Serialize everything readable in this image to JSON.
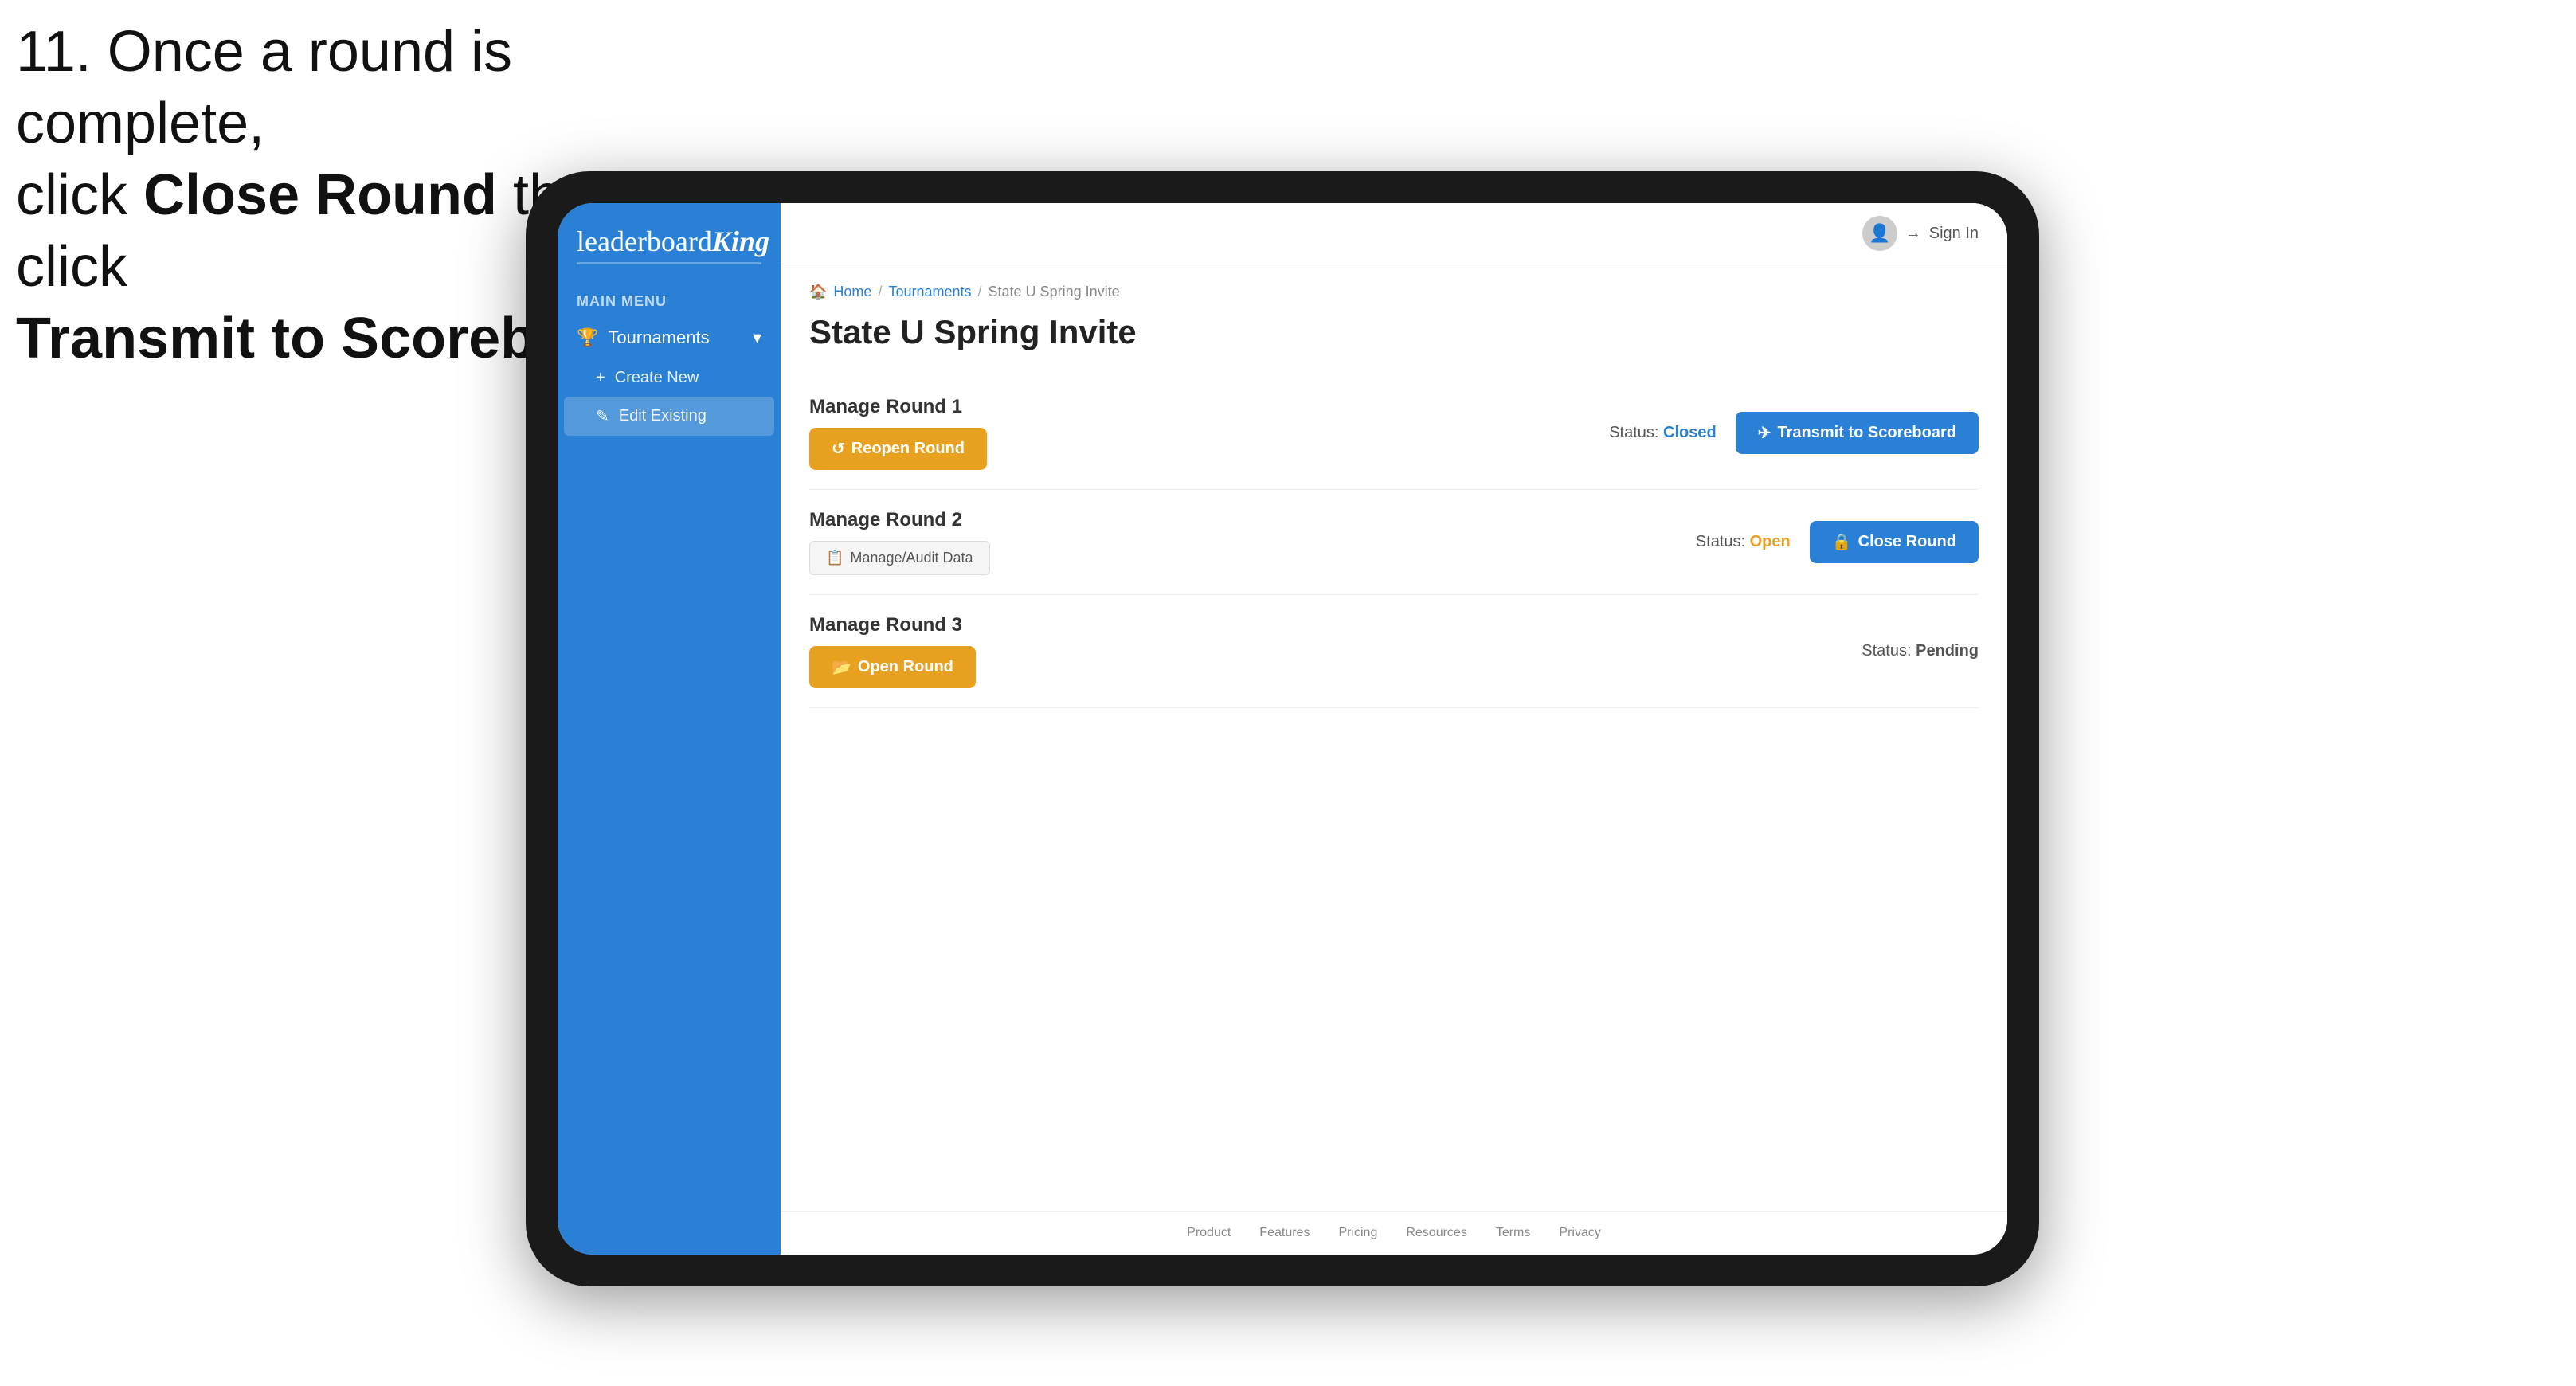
{
  "instruction": {
    "line1": "11. Once a round is complete,",
    "line2_prefix": "click ",
    "line2_bold": "Close Round",
    "line2_suffix": " then click",
    "line3_bold": "Transmit to Scoreboard."
  },
  "app": {
    "logo": {
      "leaderboard": "leaderboard",
      "king": "King"
    },
    "sidebar": {
      "main_menu_label": "MAIN MENU",
      "items": [
        {
          "label": "Tournaments",
          "icon": "trophy-icon",
          "expanded": true
        }
      ],
      "sub_items": [
        {
          "label": "Create New",
          "icon": "plus-icon"
        },
        {
          "label": "Edit Existing",
          "icon": "edit-icon",
          "active": true
        }
      ]
    },
    "header": {
      "sign_in_label": "Sign In"
    },
    "breadcrumb": {
      "home": "Home",
      "tournaments": "Tournaments",
      "current": "State U Spring Invite"
    },
    "page_title": "State U Spring Invite",
    "rounds": [
      {
        "label": "Manage Round 1",
        "status_label": "Status:",
        "status_value": "Closed",
        "status_type": "closed",
        "buttons": [
          {
            "id": "reopen",
            "label": "Reopen Round",
            "icon": "reopen-icon"
          },
          {
            "id": "transmit",
            "label": "Transmit to Scoreboard",
            "icon": "transmit-icon"
          }
        ]
      },
      {
        "label": "Manage Round 2",
        "status_label": "Status:",
        "status_value": "Open",
        "status_type": "open",
        "buttons": [
          {
            "id": "manage-audit",
            "label": "Manage/Audit Data",
            "icon": "manage-icon"
          },
          {
            "id": "close-round",
            "label": "Close Round",
            "icon": "close-icon"
          }
        ]
      },
      {
        "label": "Manage Round 3",
        "status_label": "Status:",
        "status_value": "Pending",
        "status_type": "pending",
        "buttons": [
          {
            "id": "open-round",
            "label": "Open Round",
            "icon": "open-icon"
          }
        ]
      }
    ],
    "footer": {
      "links": [
        "Product",
        "Features",
        "Pricing",
        "Resources",
        "Terms",
        "Privacy"
      ]
    }
  }
}
